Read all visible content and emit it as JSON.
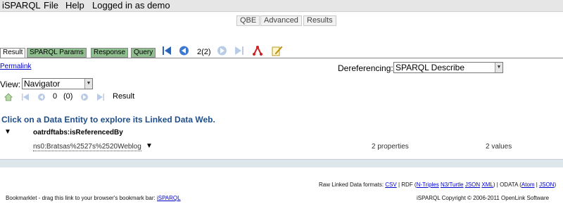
{
  "menu": {
    "app": "iSPARQL",
    "file": "File",
    "help": "Help",
    "login": "Logged in as demo"
  },
  "mode_tabs": [
    "QBE",
    "Advanced",
    "Results"
  ],
  "result_tabs": [
    "Result",
    "SPARQL Params",
    "Response",
    "Query"
  ],
  "toolbar": {
    "page_counter": "2(2)"
  },
  "permalink": "Permalink",
  "dereferencing": {
    "label": "Dereferencing:",
    "value": "SPARQL Describe"
  },
  "view": {
    "label": "View:",
    "value": "Navigator"
  },
  "nav": {
    "position": "0",
    "count": "(0)",
    "result_label": "Result"
  },
  "heading": "Click on a Data Entity to explore its Linked Data Web.",
  "tree": {
    "group_label": "oatrdftabs:isReferencedBy",
    "entity": "ns0:Bratsas%2527s%2520Weblog",
    "properties": "2 properties",
    "values": "2 values"
  },
  "footer": {
    "raw_formats_label": "Raw Linked Data formats:",
    "csv": "CSV",
    "rdf_label": "| RDF (",
    "ntriples": "N-Triples",
    "n3": "N3/Turtle",
    "json": "JSON",
    "xml": "XML",
    "odata_label": ") | ODATA (",
    "atom": "Atom",
    "sep": "|",
    "json2": "JSON",
    "close": ")",
    "bookmarklet_text": "Bookmarklet - drag this link to your browser's bookmark bar:",
    "bookmarklet_link": "iSPARQL",
    "copyright": "iSPARQL Copyright © 2006-2011 OpenLink Software"
  },
  "colors": {
    "heading": "#1f4e8c",
    "tab_inactive": "#8fbf8f",
    "band": "#dde6ea",
    "link": "#0000cc"
  }
}
